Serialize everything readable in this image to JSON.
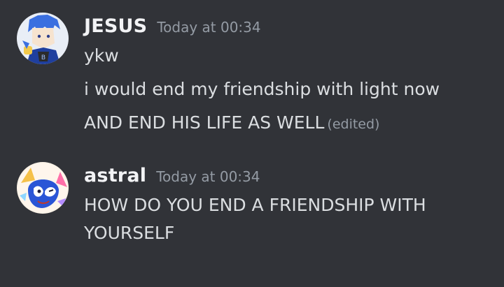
{
  "messages": [
    {
      "author": "JESUS",
      "timestamp": "Today at 00:34",
      "avatar_icon": "anime-avatar-blue-hair-icon",
      "lines": [
        {
          "text": "ykw"
        },
        {
          "text": "i would end my friendship with light now"
        },
        {
          "text": "AND END HIS LIFE AS WELL",
          "edited": "(edited)"
        }
      ]
    },
    {
      "author": "astral",
      "timestamp": "Today at 00:34",
      "avatar_icon": "cartoon-hedgehog-avatar-icon",
      "lines": [
        {
          "text": "HOW DO YOU END A FRIENDSHIP WITH"
        },
        {
          "text": "YOURSELF"
        }
      ]
    }
  ],
  "colors": {
    "background": "#313338",
    "username": "#f2f3f5",
    "message_text": "#dbdee1",
    "muted": "#949ba4"
  }
}
